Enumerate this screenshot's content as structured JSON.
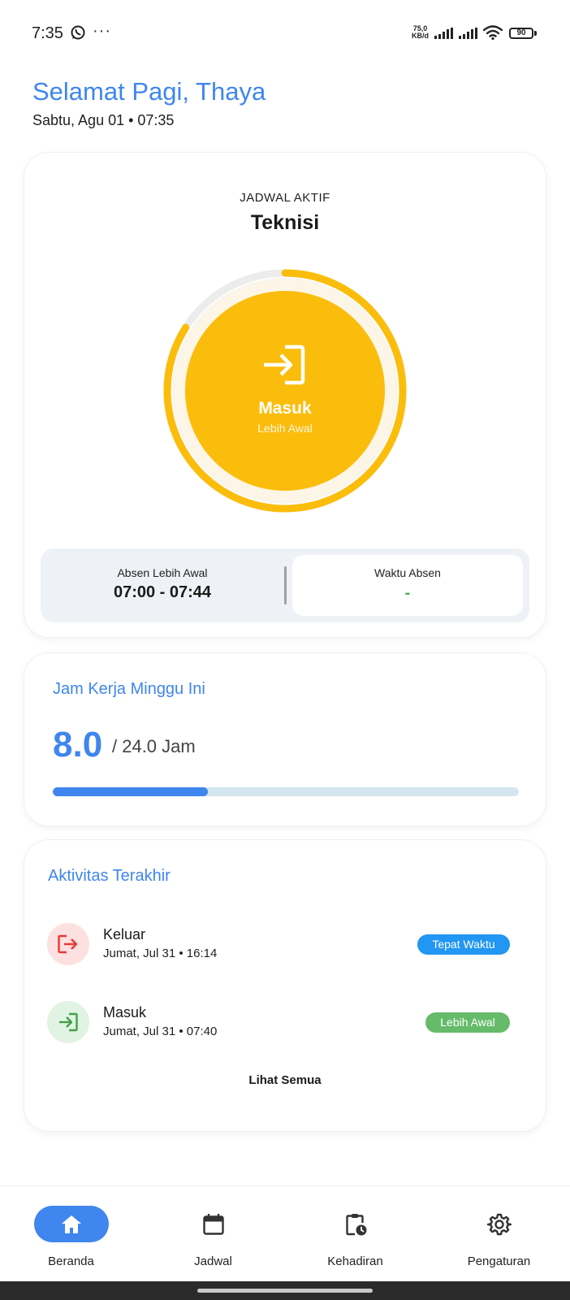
{
  "status_bar": {
    "time": "7:35",
    "more": "···",
    "net_speed_value": "75,0",
    "net_speed_unit": "KB/d",
    "battery": "90"
  },
  "header": {
    "greeting": "Selamat Pagi, Thaya",
    "date_time": "Sabtu, Agu 01 • 07:35"
  },
  "schedule": {
    "label": "JADWAL AKTIF",
    "name": "Teknisi",
    "checkin_label": "Masuk",
    "checkin_status": "Lebih Awal",
    "ring_progress": 0.84,
    "early_label": "Absen Lebih Awal",
    "early_range": "07:00 - 07:44",
    "time_label": "Waktu Absen",
    "time_value": "-"
  },
  "hours": {
    "title": "Jam Kerja Minggu Ini",
    "value": "8.0",
    "total": "/ 24.0 Jam",
    "progress": 0.3333
  },
  "activity": {
    "title": "Aktivitas Terakhir",
    "items": [
      {
        "name": "Keluar",
        "time": "Jumat, Jul 31 • 16:14",
        "badge": "Tepat Waktu",
        "icon": "logout-icon",
        "badge_color": "#2196f3",
        "icon_color": "#e53935",
        "circle_color": "#fde0e0"
      },
      {
        "name": "Masuk",
        "time": "Jumat, Jul 31 • 07:40",
        "badge": "Lebih Awal",
        "icon": "login-icon",
        "badge_color": "#66bb6a",
        "icon_color": "#43a047",
        "circle_color": "#e1f3e2"
      }
    ],
    "see_all": "Lihat Semua"
  },
  "nav": {
    "items": [
      {
        "label": "Beranda",
        "icon": "home-icon",
        "active": true
      },
      {
        "label": "Jadwal",
        "icon": "calendar-icon",
        "active": false
      },
      {
        "label": "Kehadiran",
        "icon": "attendance-clipboard-icon",
        "active": false
      },
      {
        "label": "Pengaturan",
        "icon": "gear-icon",
        "active": false
      }
    ]
  },
  "colors": {
    "accent": "#3f86ee",
    "checkin": "#fbbd0c",
    "success": "#4caf50"
  }
}
